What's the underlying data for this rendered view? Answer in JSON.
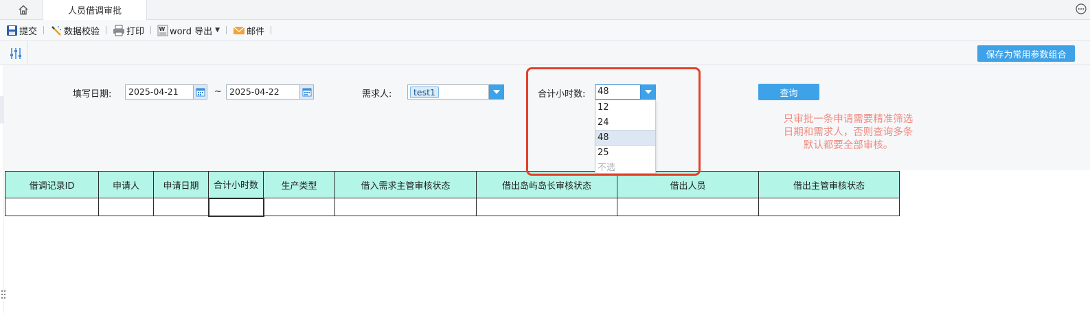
{
  "tabs": {
    "home_icon": "home-icon",
    "active_tab": "人员借调审批",
    "more_icon": "more-icon"
  },
  "toolbar": {
    "submit": "提交",
    "validate": "数据校验",
    "print": "打印",
    "word_export": "word 导出",
    "mail": "邮件"
  },
  "parambar": {
    "save_combo": "保存为常用参数组合"
  },
  "filters": {
    "date_label": "填写日期:",
    "date_from": "2025-04-21",
    "date_sep": "~",
    "date_to": "2025-04-22",
    "requester_label": "需求人:",
    "requester_tag": "test1",
    "hours_label": "合计小时数:",
    "hours_value": "48",
    "query": "查询",
    "hours_options": [
      "12",
      "24",
      "48",
      "25",
      "不选"
    ],
    "hours_selected_index": 2
  },
  "note": {
    "lines": [
      "只审批一条申请需要精准筛选",
      "日期和需求人，否则查询多条",
      "默认都要全部审核。"
    ],
    "color": "#f08a80"
  },
  "table": {
    "headers": [
      "借调记录ID",
      "申请人",
      "申请日期",
      "合计小时数",
      "生产类型",
      "借入需求主管审核状态",
      "借出岛屿岛长审核状态",
      "借出人员",
      "借出主管审核状态"
    ],
    "rows": [
      [
        "",
        "",
        "",
        "",
        "",
        "",
        "",
        "",
        ""
      ]
    ]
  },
  "colors": {
    "accent": "#3ea2e8",
    "header_bg": "#b3f6e7",
    "highlight": "#e2402b"
  }
}
